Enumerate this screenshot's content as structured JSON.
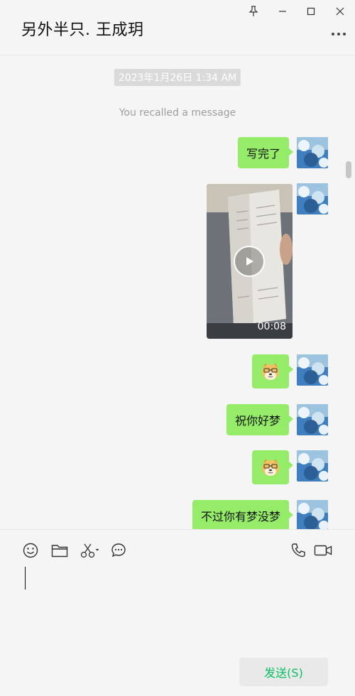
{
  "chat": {
    "title": "另外半只. 王成玥"
  },
  "messages": {
    "timestamp": "2023年1月26日 1:34 AM",
    "system_note": "You recalled a message",
    "items": [
      {
        "type": "text",
        "text": "写完了"
      },
      {
        "type": "video",
        "duration": "00:08"
      },
      {
        "type": "emoji",
        "emoji": "doge-emoji"
      },
      {
        "type": "text",
        "text": "祝你好梦"
      },
      {
        "type": "emoji",
        "emoji": "doge-emoji"
      },
      {
        "type": "text",
        "text": "不过你有梦没梦"
      }
    ]
  },
  "input": {
    "value": "",
    "send_label": "发送(S)"
  },
  "colors": {
    "bubble": "#95ec69",
    "send_text": "#07c160",
    "background": "#f5f5f5"
  }
}
